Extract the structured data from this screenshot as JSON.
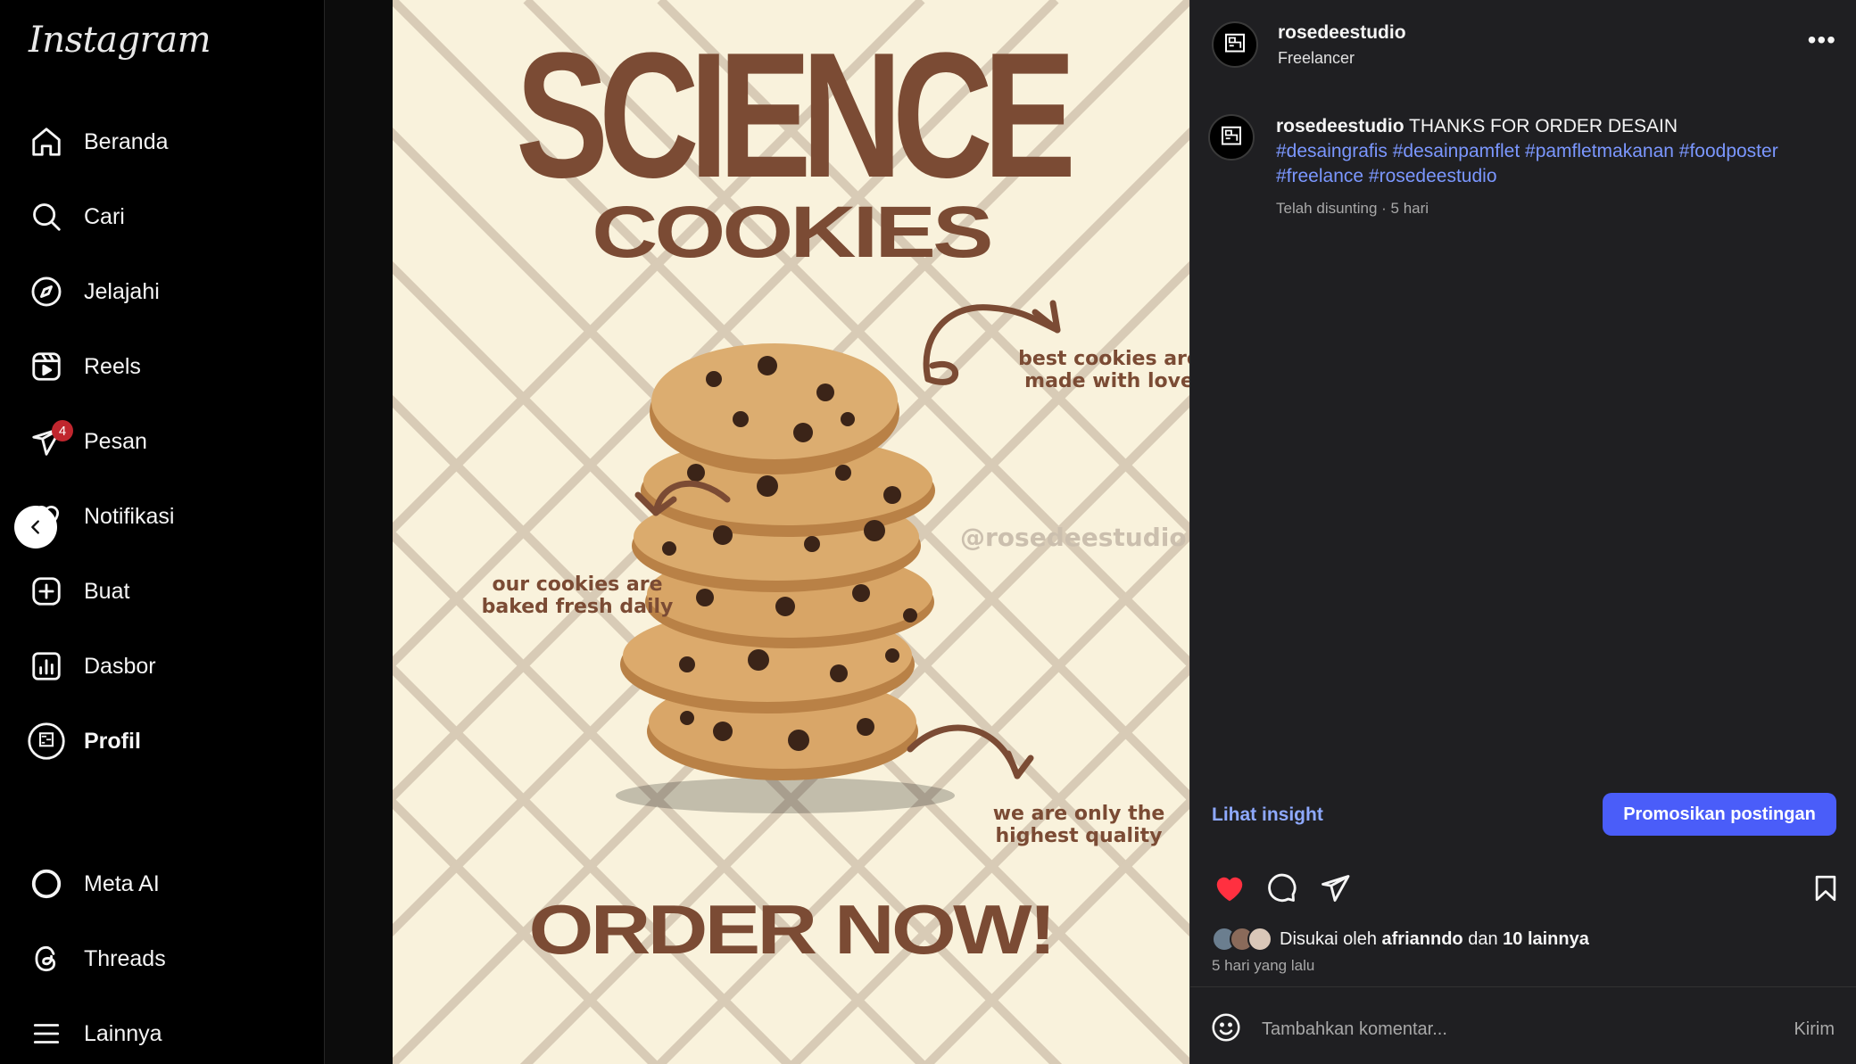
{
  "app": {
    "logo_text": "Instagram"
  },
  "sidebar": {
    "items": [
      {
        "label": "Beranda",
        "icon": "home-icon"
      },
      {
        "label": "Cari",
        "icon": "search-icon"
      },
      {
        "label": "Jelajahi",
        "icon": "compass-icon"
      },
      {
        "label": "Reels",
        "icon": "reels-icon"
      },
      {
        "label": "Pesan",
        "icon": "paper-plane-icon",
        "badge": "4"
      },
      {
        "label": "Notifikasi",
        "icon": "heart-icon"
      },
      {
        "label": "Buat",
        "icon": "plus-square-icon"
      },
      {
        "label": "Dasbor",
        "icon": "dashboard-icon"
      },
      {
        "label": "Profil",
        "icon": "avatar"
      },
      {
        "label": "Meta AI",
        "icon": "meta-ai-icon"
      },
      {
        "label": "Threads",
        "icon": "threads-icon"
      },
      {
        "label": "Lainnya",
        "icon": "menu-icon"
      }
    ]
  },
  "post_image": {
    "title_line1": "SCIENCE",
    "title_line2": "COOKIES",
    "annotation_top_right": [
      "best cookies are",
      "made with love"
    ],
    "annotation_left": [
      "our cookies are",
      "baked fresh daily"
    ],
    "annotation_bottom_right": [
      "we are only the",
      "highest quality"
    ],
    "watermark": "@rosedeestudio",
    "cta": "ORDER NOW!",
    "colors": {
      "background": "#f9f2dc",
      "brown": "#7b4b34",
      "grid": "#d8cbb6"
    }
  },
  "post": {
    "username": "rosedeestudio",
    "subtitle": "Freelancer",
    "caption_text": "THANKS FOR ORDER DESAIN",
    "hashtags": "#desaingrafis #desainpamflet #pamfletmakanan #foodposter #freelance #rosedeestudio",
    "caption_meta": "Telah disunting · 5 hari",
    "insight_label": "Lihat insight",
    "promote_label": "Promosikan postingan",
    "liked_prefix": "Disukai oleh",
    "liked_user": "afrianndo",
    "liked_conj": "dan",
    "liked_others": "10 lainnya",
    "time_ago": "5 hari yang lalu",
    "comment_placeholder": "Tambahkan komentar...",
    "send_label": "Kirim",
    "accent_color": "#4a5df9",
    "like_color": "#ff3040"
  }
}
